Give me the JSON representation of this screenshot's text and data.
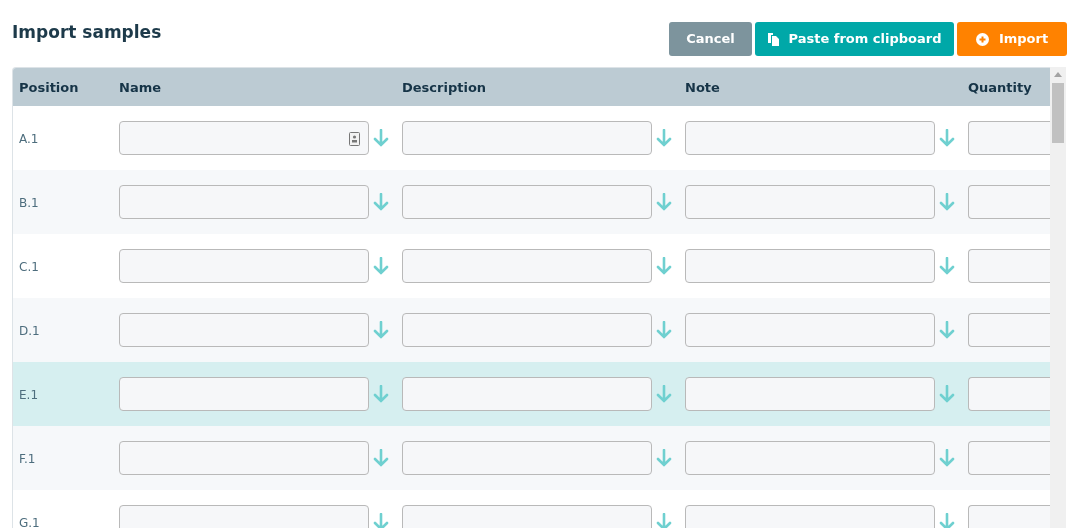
{
  "title": "Import samples",
  "buttons": [
    {
      "label": "Cancel",
      "kind": "cancel"
    },
    {
      "label": "Paste from clipboard",
      "kind": "paste"
    },
    {
      "label": "Import",
      "kind": "import"
    }
  ],
  "table": {
    "columns": [
      "Position",
      "Name",
      "Description",
      "Note",
      "Quantity"
    ],
    "rows": [
      {
        "position": "A.1",
        "highlighted": false,
        "name_icon": true
      },
      {
        "position": "B.1",
        "highlighted": false,
        "name_icon": false
      },
      {
        "position": "C.1",
        "highlighted": false,
        "name_icon": false
      },
      {
        "position": "D.1",
        "highlighted": false,
        "name_icon": false
      },
      {
        "position": "E.1",
        "highlighted": true,
        "name_icon": false
      },
      {
        "position": "F.1",
        "highlighted": false,
        "name_icon": false
      },
      {
        "position": "G.1",
        "highlighted": false,
        "name_icon": false
      }
    ]
  }
}
